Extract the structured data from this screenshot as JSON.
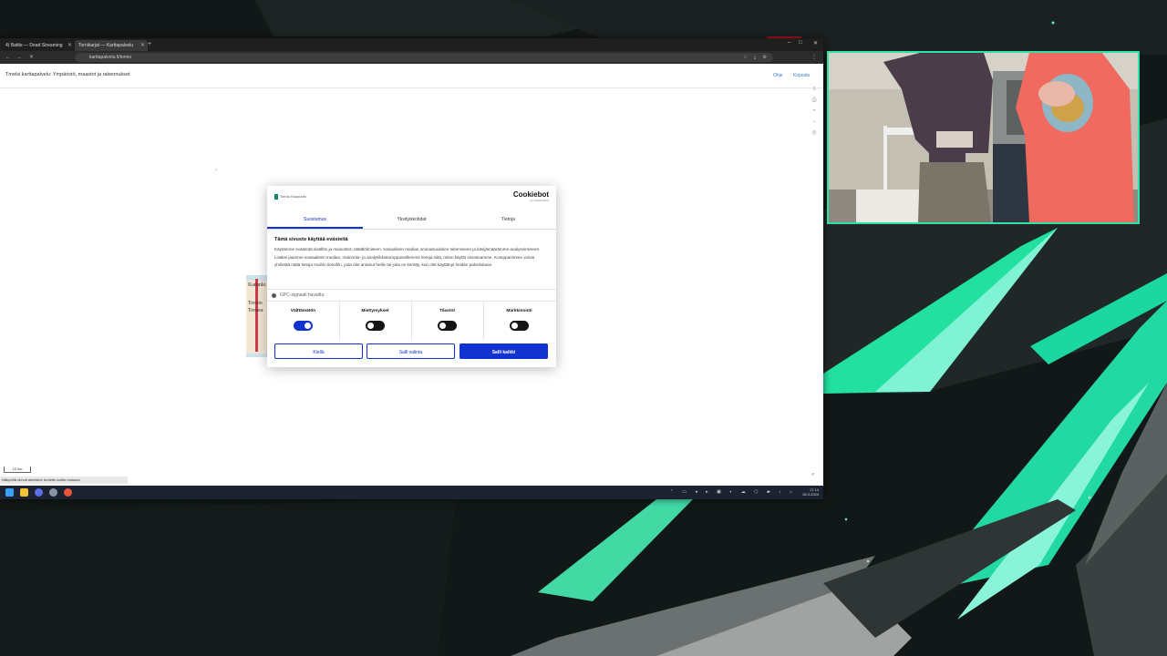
{
  "browser": {
    "tabs": [
      {
        "label": "4) Battle — Dead Streaming",
        "close": "✕"
      },
      {
        "label": "Tornikarjat — Karttapalvelu",
        "close": "✕"
      }
    ],
    "new_tab": "+",
    "window_controls": {
      "minimize": "–",
      "maximize": "□",
      "close": "✕"
    },
    "nav": {
      "back": "←",
      "forward": "→",
      "reload": "✕"
    },
    "url": "karttapalvelu.fi/tornio"
  },
  "site": {
    "title": "Tmelsi karttapalvelu: Ympäristö, maastot ja rakennukset",
    "links": [
      "Ohje",
      "Kirjaudu"
    ],
    "tools": [
      "list-icon",
      "print-icon",
      "zoom-in-icon",
      "zoom-out-icon",
      "locate-icon"
    ],
    "map_labels": [
      "Karunki",
      "Tornio",
      "Tornea"
    ],
    "scale": "10 km",
    "status": "Näkyvillä olevat aineistot: tuotettu kartta mukaan",
    "chevron": "›"
  },
  "cookie_dialog": {
    "brand": "Tornio Kaupunki",
    "cookiebot": {
      "name": "Cookiebot",
      "sub": "by Usercentrics"
    },
    "tabs": [
      "Suostumus",
      "Yksityiskohdat",
      "Tietoja"
    ],
    "active_tab": 0,
    "heading": "Tämä sivusto käyttää evästeitä",
    "body": "Käytämme evästeitä sisällön ja mainosten räätälöimiseen, sosiaalisen median ominaisuuksien tukemiseen ja kävijämäärämme analysoimiseen. Lisäksi jaamme sosiaalisen median, mainonta- ja analytiikkakumppaneillemme tietoja siitä, miten käytät sivustoamme. Kumppanimme voivat yhdistää näitä tietoja muihin tietoihin, joita olet antanut heille tai joita on kerätty, kun olet käyttänyt heidän palveluitaan.",
    "gpc_label": "GPC-signaali havaittu",
    "toggles": [
      {
        "label": "Välttämätön",
        "on": true
      },
      {
        "label": "Mieltymykset",
        "on": false
      },
      {
        "label": "Tilastot",
        "on": false
      },
      {
        "label": "Markkinointi",
        "on": false
      }
    ],
    "buttons": {
      "deny": "Kiellä",
      "allow_selection": "Salli valinta",
      "allow_all": "Salli kaikki"
    }
  },
  "taskbar": {
    "icons": [
      "windows-icon",
      "file-explorer-icon",
      "browser-icon",
      "steam-icon",
      "firefox-icon"
    ],
    "tray": "⌃ ▭ ◂ ▸ ▣ ◐ ☁ ⬡ ▰ ♪ ⌂",
    "time": "17.14",
    "date": "28.3.2024"
  },
  "colors": {
    "accent": "#1032cf",
    "webcam_border": "#2fe3a8",
    "overlay_green": "#2fe3a8"
  }
}
